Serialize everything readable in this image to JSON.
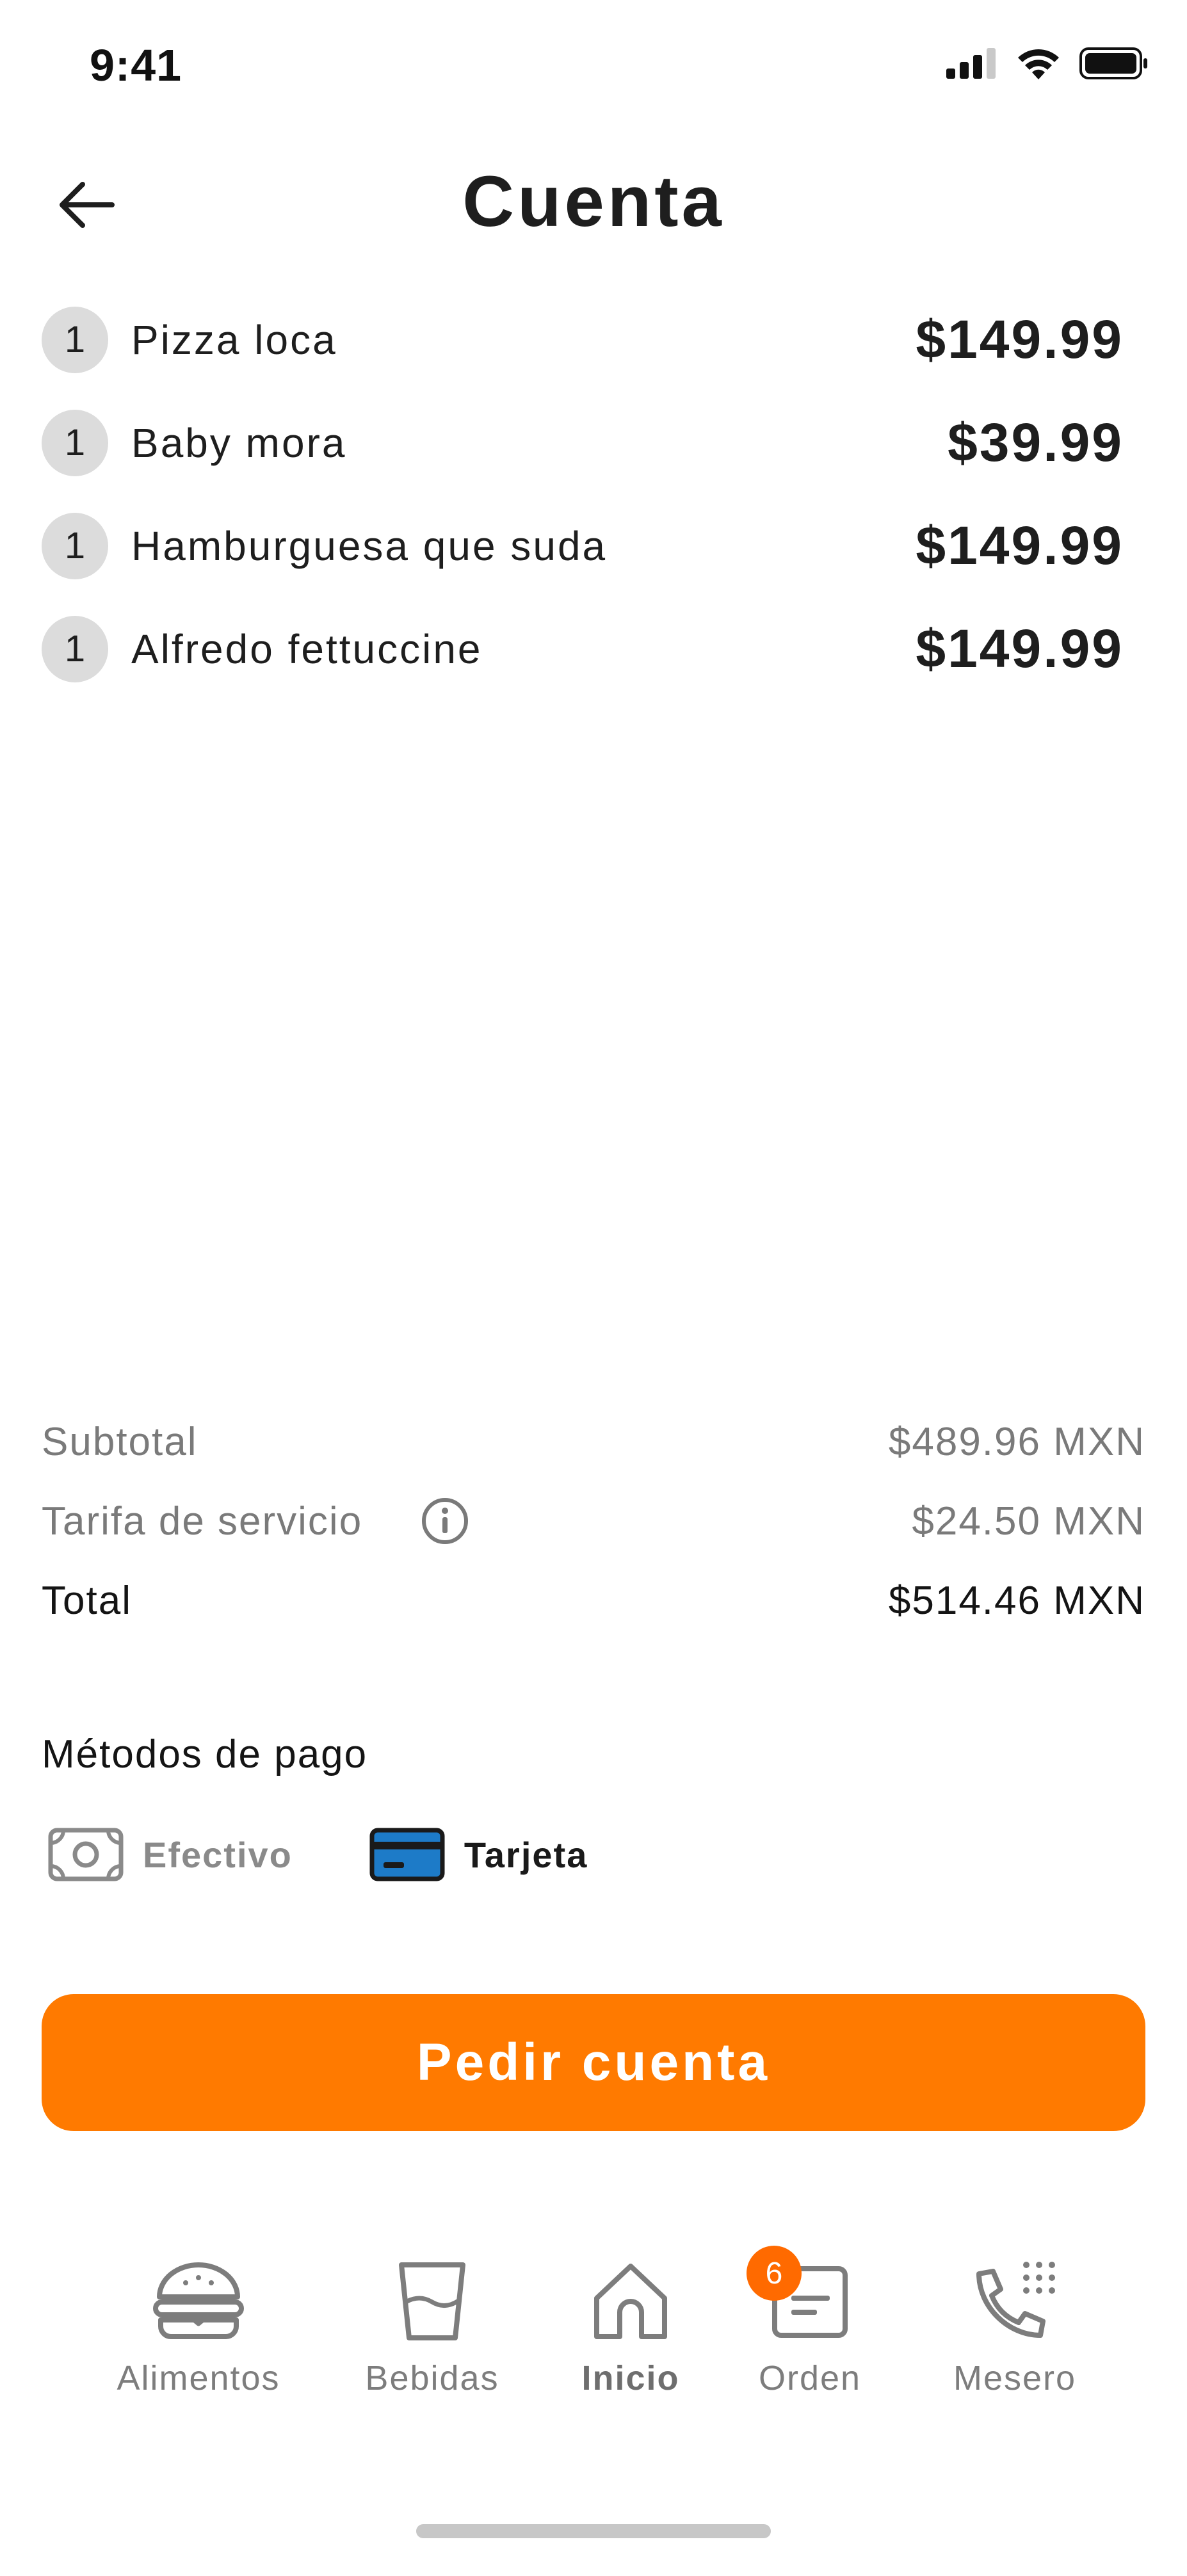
{
  "status_bar": {
    "time": "9:41"
  },
  "header": {
    "title": "Cuenta",
    "back_icon": "arrow-left-icon"
  },
  "items": [
    {
      "qty": "1",
      "name": "Pizza loca",
      "price": "$149.99"
    },
    {
      "qty": "1",
      "name": "Baby mora",
      "price": "$39.99"
    },
    {
      "qty": "1",
      "name": "Hamburguesa que suda",
      "price": "$149.99"
    },
    {
      "qty": "1",
      "name": "Alfredo fettuccine",
      "price": "$149.99"
    }
  ],
  "summary": {
    "subtotal_label": "Subtotal",
    "subtotal_value": "$489.96 MXN",
    "fee_label": "Tarifa de servicio",
    "fee_value": "$24.50 MXN",
    "total_label": "Total",
    "total_value": "$514.46 MXN"
  },
  "payment": {
    "title": "Métodos de pago",
    "options": [
      {
        "label": "Efectivo",
        "icon": "cash-icon",
        "selected": false
      },
      {
        "label": "Tarjeta",
        "icon": "credit-card-icon",
        "selected": true
      }
    ]
  },
  "cta": {
    "label": "Pedir cuenta"
  },
  "bottom_nav": {
    "items": [
      {
        "label": "Alimentos",
        "icon": "burger-icon"
      },
      {
        "label": "Bebidas",
        "icon": "glass-icon"
      },
      {
        "label": "Inicio",
        "icon": "home-icon",
        "active": true
      },
      {
        "label": "Orden",
        "icon": "order-icon",
        "badge": "6"
      },
      {
        "label": "Mesero",
        "icon": "phone-icon"
      }
    ]
  },
  "colors": {
    "accent": "#ff7a00",
    "badge": "#ff6a00",
    "card_blue": "#1d7bc8",
    "muted_text": "#7a7a7a"
  }
}
